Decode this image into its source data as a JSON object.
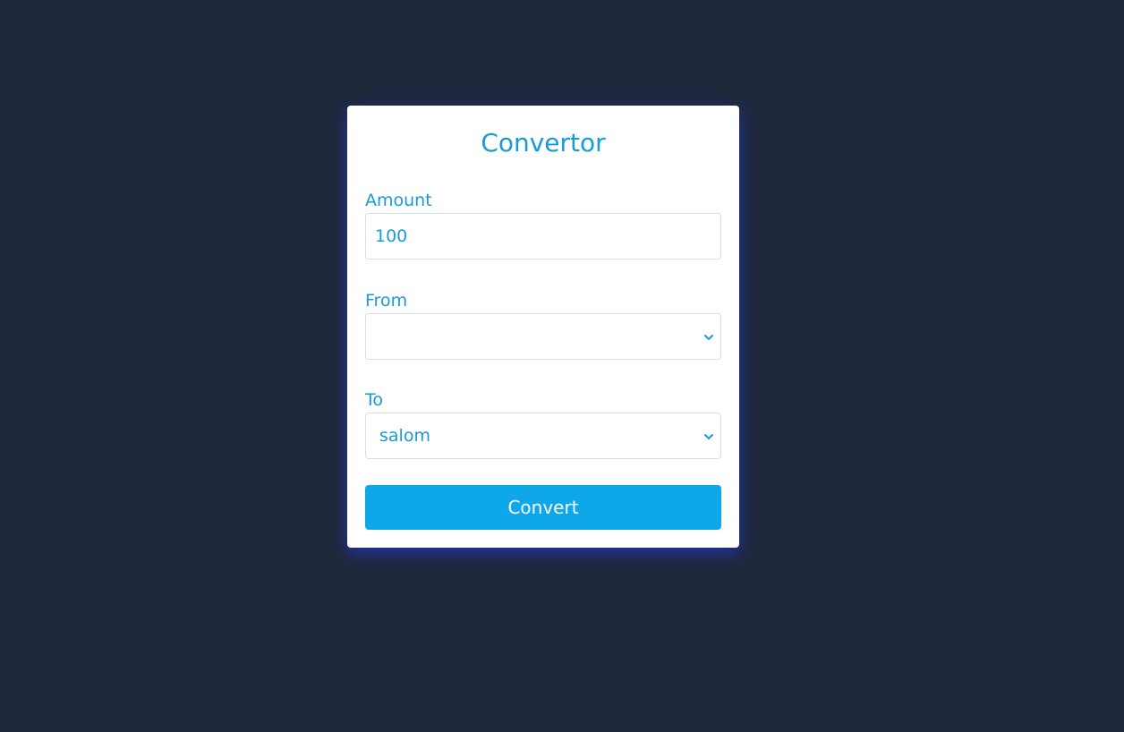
{
  "form": {
    "title": "Convertor",
    "amount": {
      "label": "Amount",
      "value": "100"
    },
    "from": {
      "label": "From",
      "selected": ""
    },
    "to": {
      "label": "To",
      "selected": "salom"
    },
    "convert_label": "Convert"
  },
  "icons": {
    "select_arrow": "chevron-down-icon"
  },
  "colors": {
    "background": "#1f283b",
    "accent": "#199bd6",
    "button": "#0ea8ea"
  }
}
